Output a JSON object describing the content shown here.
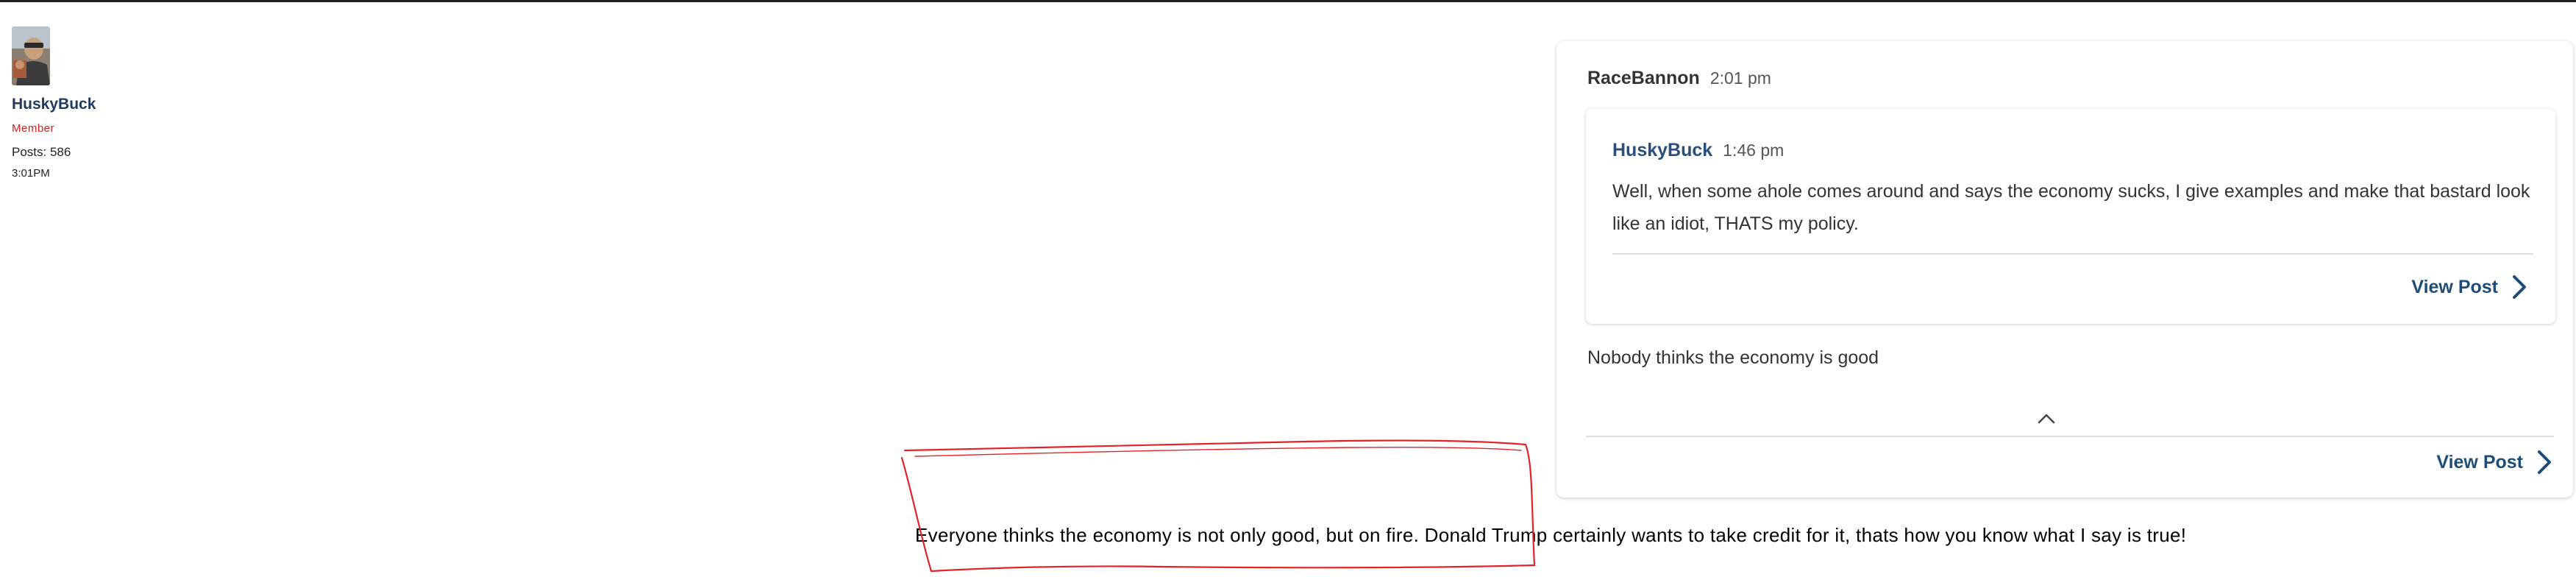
{
  "author": {
    "name": "HuskyBuck",
    "rank": "Member",
    "posts": "Posts: 586",
    "time": "3:01PM",
    "avatar_icon": "user-photo-icon"
  },
  "quote": {
    "username": "RaceBannon",
    "time": "2:01 pm",
    "nested": {
      "username": "HuskyBuck",
      "time": "1:46 pm",
      "body": "Well, when some ahole comes around and says the economy sucks, I give examples and make that bastard look like an idiot, THATS my policy.",
      "view_post_label": "View Post"
    },
    "body": "Nobody thinks the economy is good",
    "collapse_icon": "chevron-up-icon",
    "view_post_label": "View Post"
  },
  "reply": {
    "text": "Everyone thinks the economy is not only good, but on fire. Donald Trump certainly wants to take credit for it, thats how you know what I say is true!",
    "annotation_color": "#e0242a"
  },
  "colors": {
    "link": "#1e4d78",
    "username": "#1e3a5f",
    "rank": "#d21f1f"
  }
}
